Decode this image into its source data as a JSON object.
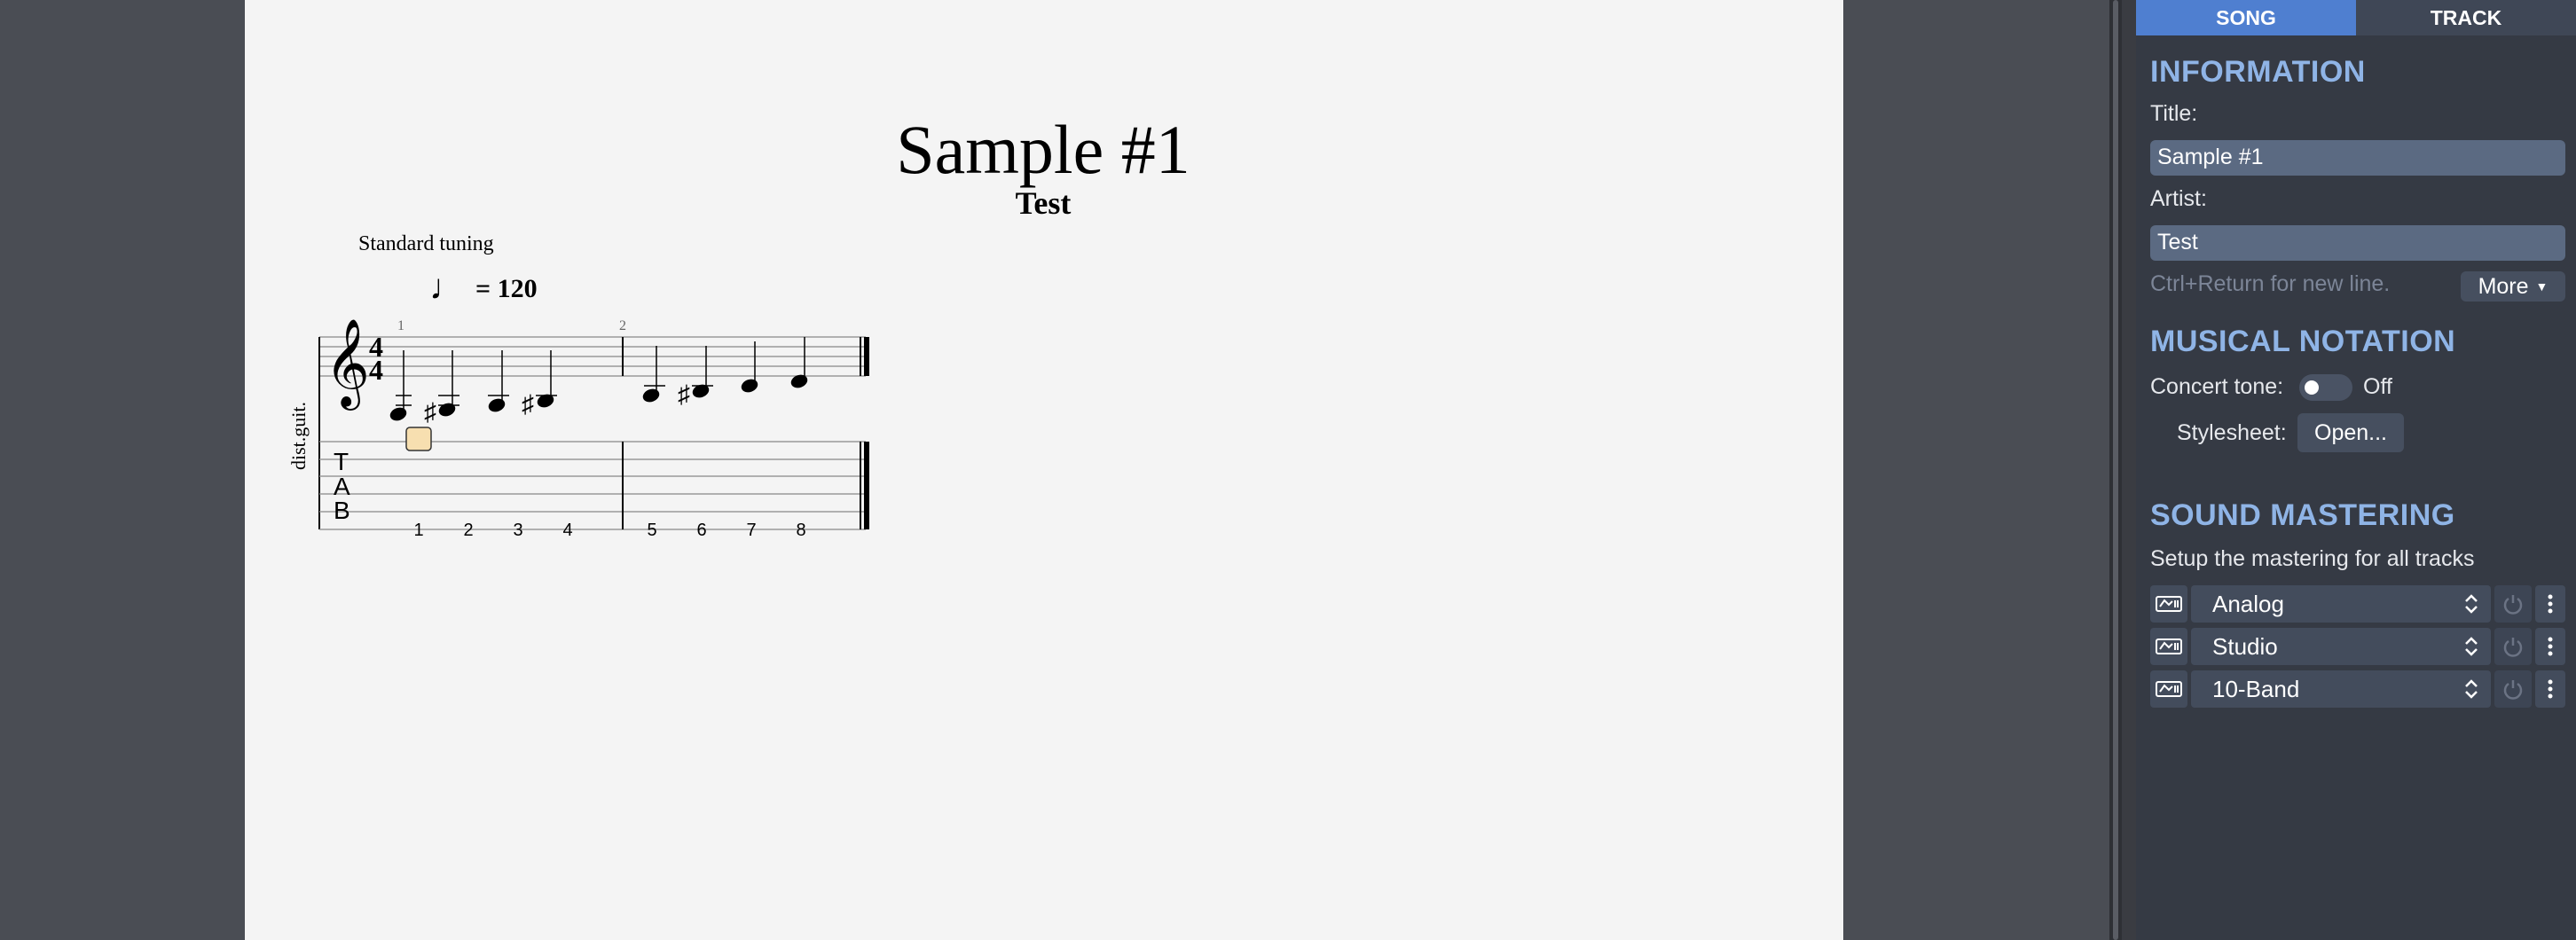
{
  "score": {
    "title": "Sample #1",
    "artist": "Test",
    "tuning": "Standard tuning",
    "tempo": "= 120",
    "track_name": "dist.guit.",
    "bar_numbers": [
      "1",
      "2"
    ],
    "time_signature": {
      "top": "4",
      "bottom": "4"
    },
    "tab_clef": [
      "T",
      "A",
      "B"
    ],
    "tab_frets": [
      "1",
      "2",
      "3",
      "4",
      "5",
      "6",
      "7",
      "8"
    ]
  },
  "panel": {
    "tabs": [
      {
        "label": "SONG"
      },
      {
        "label": "TRACK"
      }
    ],
    "information": {
      "heading": "INFORMATION",
      "title_label": "Title:",
      "title_value": "Sample #1",
      "artist_label": "Artist:",
      "artist_value": "Test",
      "hint": "Ctrl+Return for new line.",
      "more_label": "More"
    },
    "notation": {
      "heading": "MUSICAL NOTATION",
      "concert_label": "Concert tone:",
      "concert_state": "Off",
      "stylesheet_label": "Stylesheet:",
      "open_label": "Open..."
    },
    "mastering": {
      "heading": "SOUND MASTERING",
      "subtitle": "Setup the mastering for all tracks",
      "effects": [
        {
          "name": "Analog"
        },
        {
          "name": "Studio"
        },
        {
          "name": "10-Band"
        }
      ]
    }
  },
  "colors": {
    "accent": "#4f7fd0",
    "heading": "#8fb4e6",
    "panel_bg": "#353a44",
    "page_bg": "#f4f4f4"
  }
}
